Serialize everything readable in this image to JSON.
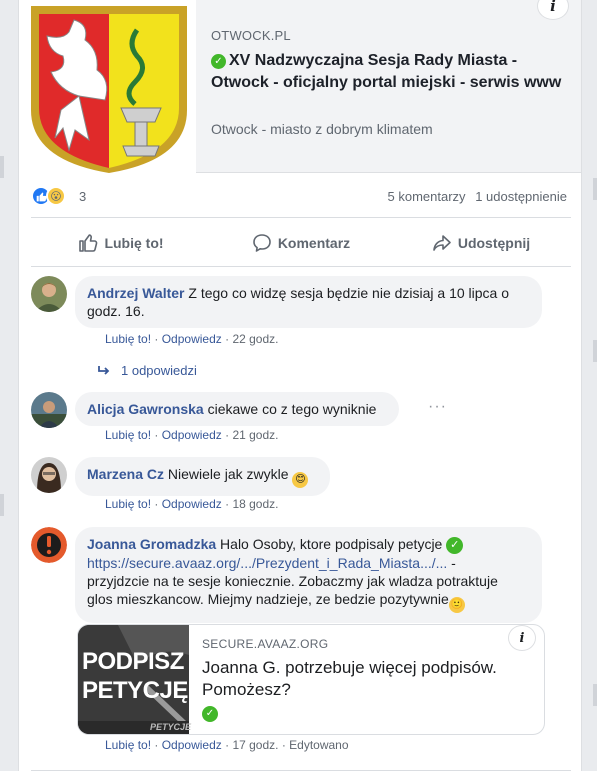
{
  "post": {
    "preview": {
      "domain": "OTWOCK.PL",
      "title": "XV Nadzwyczajna Sesja Rady Miasta - Otwock - oficjalny portal miejski - serwis www",
      "description": "Otwock - miasto z dobrym klimatem",
      "info_label": "i"
    },
    "reactions": {
      "count": "3",
      "comments": "5 komentarzy",
      "shares": "1 udostępnienie"
    },
    "actions": {
      "like": "Lubię to!",
      "comment": "Komentarz",
      "share": "Udostępnij"
    }
  },
  "comments": [
    {
      "author": "Andrzej Walter",
      "text_line1": "Z tego co widzę sesja będzie nie dzisiaj a 10 lipca o",
      "text_line2": "godz. 16.",
      "like": "Lubię to!",
      "reply": "Odpowiedz",
      "time": "22 godz.",
      "replies": "1 odpowiedzi"
    },
    {
      "author": "Alicja Gawronska",
      "text": "ciekawe co z tego wyniknie",
      "like": "Lubię to!",
      "reply": "Odpowiedz",
      "time": "21 godz."
    },
    {
      "author": "Marzena Cz",
      "text": "Niewiele jak zwykle",
      "like": "Lubię to!",
      "reply": "Odpowiedz",
      "time": "18 godz."
    },
    {
      "author": "Joanna Gromadzka",
      "text_a": "Halo Osoby, ktore podpisaly petycje",
      "link": "https://secure.avaaz.org/.../Prezydent_i_Rada_Miasta.../...",
      "text_b": " -",
      "text_line3": "przyjdzcie na te sesje koniecznie. Zobaczmy jak wladza potraktuje",
      "text_line4": "glos mieszkancow. Miejmy nadzieje, ze bedzie pozytywnie",
      "like": "Lubię to!",
      "reply": "Odpowiedz",
      "time": "17 godz.",
      "edited": "Edytowano",
      "preview": {
        "domain": "SECURE.AVAAZ.ORG",
        "title": "Joanna G. potrzebuje więcej podpisów. Pomożesz?",
        "image_text_line1": "PODPISZ",
        "image_text_line2": "PETYCJĘ",
        "image_caption": "PETYCJE"
      }
    }
  ],
  "colors": {
    "link_blue": "#385898",
    "like_blue": "#2078f4",
    "verified_green": "#42b72a",
    "bubble_bg": "#f2f3f5"
  }
}
